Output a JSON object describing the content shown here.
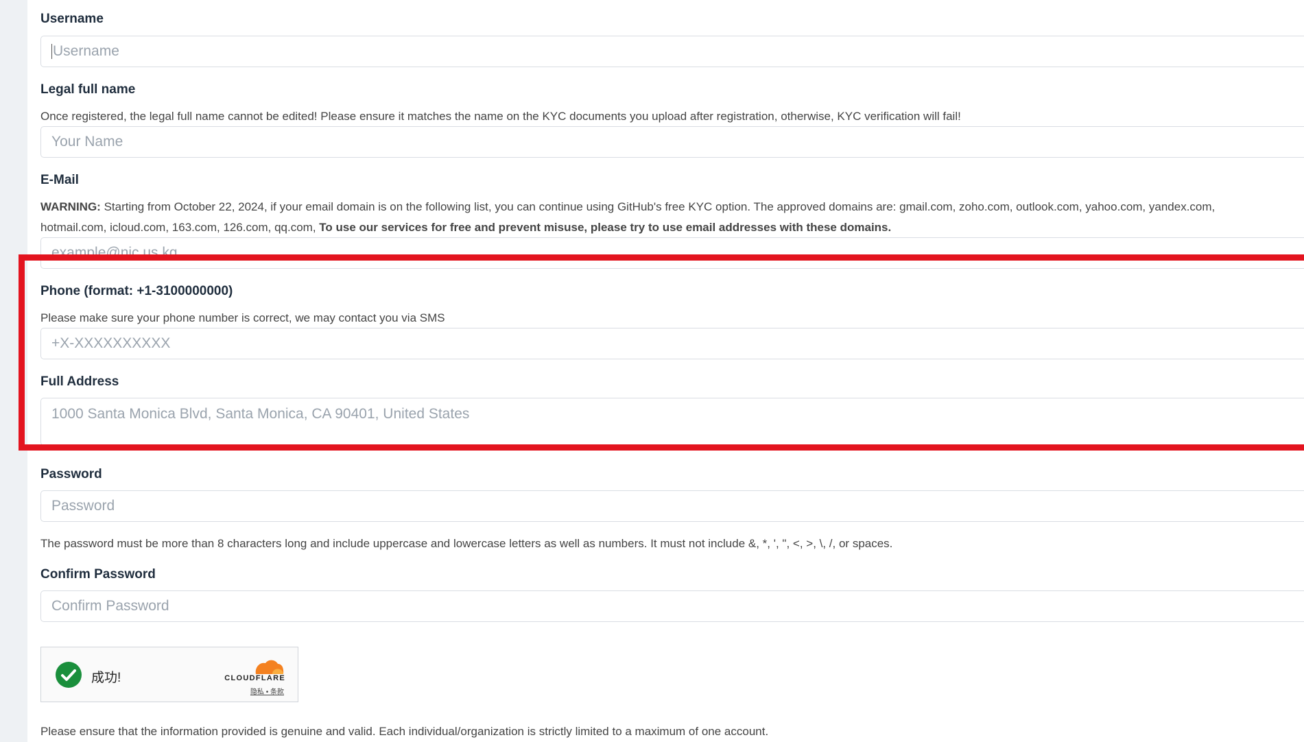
{
  "form": {
    "username": {
      "label": "Username",
      "placeholder": "Username"
    },
    "legal_name": {
      "label": "Legal full name",
      "help": "Once registered, the legal full name cannot be edited! Please ensure it matches the name on the KYC documents you upload after registration, otherwise, KYC verification will fail!",
      "placeholder": "Your Name"
    },
    "email": {
      "label": "E-Mail",
      "warning_prefix": "WARNING:",
      "warning_line1": "Starting from October 22, 2024, if your email domain is on the following list, you can continue using GitHub's free KYC option. The approved domains are: gmail.com, zoho.com, outlook.com, yahoo.com, yandex.com,",
      "warning_line2": "hotmail.com, icloud.com, 163.com, 126.com, qq.com,",
      "warning_bold": "To use our services for free and prevent misuse, please try to use email addresses with these domains.",
      "placeholder": "example@nic.us.kg"
    },
    "phone": {
      "label": "Phone (format: +1-3100000000)",
      "help": "Please make sure your phone number is correct, we may contact you via SMS",
      "placeholder": "+X-XXXXXXXXXX"
    },
    "address": {
      "label": "Full Address",
      "placeholder": "1000 Santa Monica Blvd, Santa Monica, CA 90401, United States"
    },
    "password": {
      "label": "Password",
      "placeholder": "Password",
      "help": "The password must be more than 8 characters long and include uppercase and lowercase letters as well as numbers. It must not include &, *, ', \", <, >, \\, /, or spaces."
    },
    "confirm_password": {
      "label": "Confirm Password",
      "placeholder": "Confirm Password"
    },
    "captcha": {
      "status": "成功!",
      "brand": "CLOUDFLARE",
      "links": "隐私 • 条款"
    },
    "footer_note": "Please ensure that the information provided is genuine and valid. Each individual/organization is strictly limited to a maximum of one account."
  },
  "colors": {
    "highlight": "#e3141f",
    "success": "#1a8f3c",
    "cloudflare_orange": "#f48120"
  }
}
